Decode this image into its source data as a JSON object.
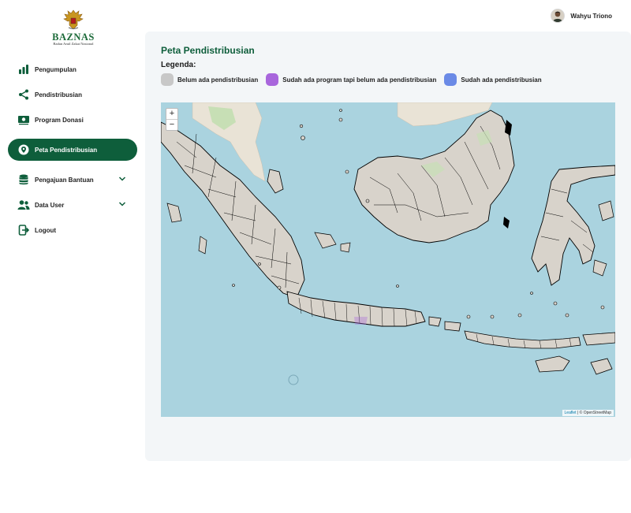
{
  "logo": {
    "brand": "BAZNAS",
    "subtitle": "Badan Amil Zakat Nasional"
  },
  "sidebar": {
    "items": [
      {
        "label": "Pengumpulan",
        "icon": "bar-chart-icon"
      },
      {
        "label": "Pendistribusian",
        "icon": "share-icon"
      },
      {
        "label": "Program Donasi",
        "icon": "money-icon"
      },
      {
        "label": "Peta Pendistribusian",
        "icon": "map-pin-icon",
        "active": true
      },
      {
        "label": "Pengajuan Bantuan",
        "icon": "database-icon",
        "expandable": true
      },
      {
        "label": "Data User",
        "icon": "users-icon",
        "expandable": true
      },
      {
        "label": "Logout",
        "icon": "logout-icon"
      }
    ]
  },
  "user": {
    "name": "Wahyu Triono"
  },
  "main": {
    "title": "Peta Pendistribusian",
    "legend_title": "Legenda:",
    "legend": [
      {
        "label": "Belum ada pendistribusian",
        "color": "#c8c8c8"
      },
      {
        "label": "Sudah ada program tapi belum ada pendistribusian",
        "color": "#a866dc"
      },
      {
        "label": "Sudah ada pendistribusian",
        "color": "#6a8ae6"
      }
    ]
  },
  "map": {
    "zoom_in": "+",
    "zoom_out": "−",
    "attribution_leaflet": "Leaflet",
    "attribution_osm": "| © OpenStreetMap"
  },
  "colors": {
    "primary": "#0e5e3b",
    "panel_bg": "#f3f6f8",
    "sea": "#aad3df"
  }
}
